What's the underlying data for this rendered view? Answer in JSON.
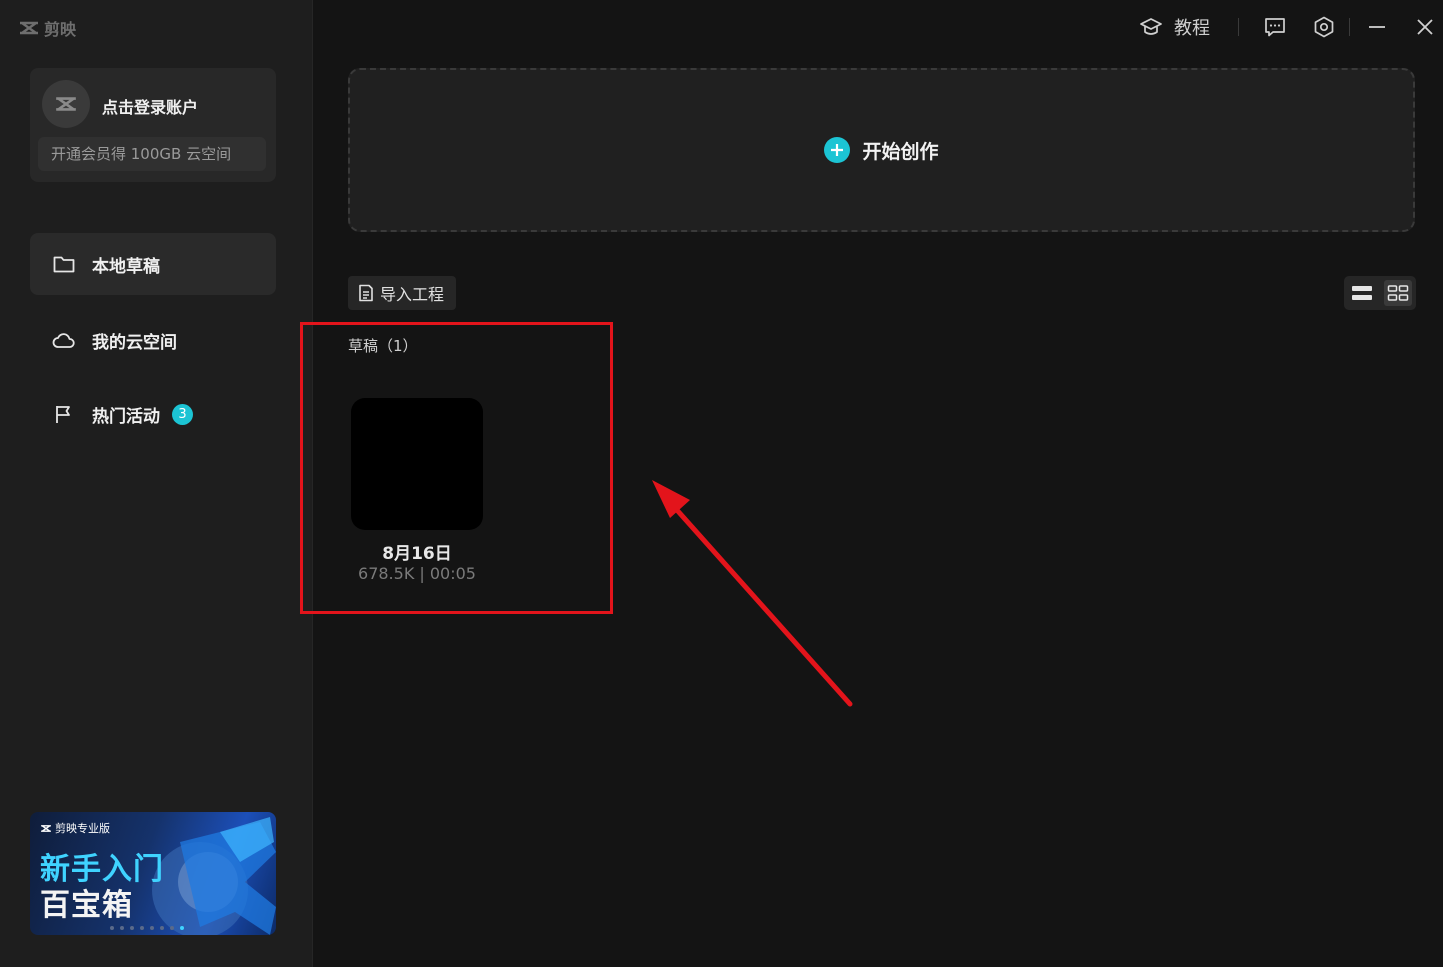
{
  "app": {
    "name": "剪映"
  },
  "account": {
    "login_label": "点击登录账户",
    "vip_promo": "开通会员得 100GB 云空间"
  },
  "sidebar": {
    "items": [
      {
        "label": "本地草稿",
        "icon": "folder-icon",
        "active": true
      },
      {
        "label": "我的云空间",
        "icon": "cloud-icon",
        "active": false
      },
      {
        "label": "热门活动",
        "icon": "flag-icon",
        "active": false,
        "badge": "3"
      }
    ]
  },
  "banner": {
    "brand": "剪映专业版",
    "line1": "新手入门",
    "line2": "百宝箱"
  },
  "topbar": {
    "tutorial_label": "教程"
  },
  "create": {
    "label": "开始创作"
  },
  "toolbar": {
    "import_label": "导入工程"
  },
  "drafts": {
    "count_label": "草稿（1）",
    "items": [
      {
        "name": "8月16日",
        "meta": "678.5K | 00:05"
      }
    ]
  },
  "colors": {
    "accent": "#1cc4d4",
    "highlight": "#e3141b"
  }
}
